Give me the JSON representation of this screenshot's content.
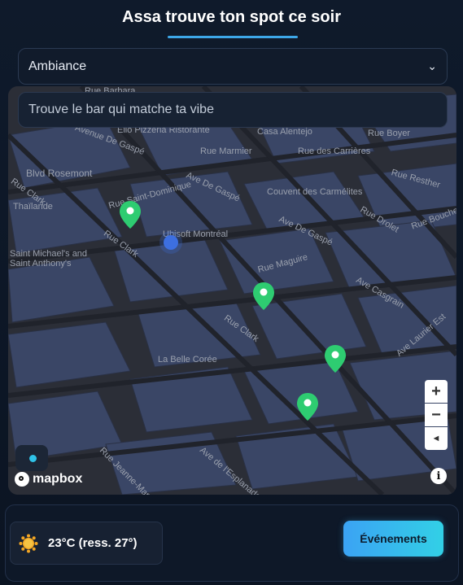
{
  "header": {
    "title": "Assa trouve ton spot ce soir"
  },
  "filter": {
    "selected": "Ambiance"
  },
  "search": {
    "placeholder": "Trouve le bar qui matche ta vibe"
  },
  "map": {
    "street_labels": [
      "Rue Saint-Dominique",
      "Rue Marmier",
      "Rue des Carrières",
      "Rue Boyer",
      "Rue Resther",
      "Blvd Rosemont",
      "Rue Clark",
      "Avenue De Gaspé",
      "Ave De Gaspé",
      "Rue Drolet",
      "Rue Boucher",
      "Rue Maguire",
      "Ave Casgrain",
      "Ave Laurier Est",
      "Ave de l'Esplanade",
      "Rue Jeanne-Mance"
    ],
    "poi_labels": [
      "Elio Pizzeria Ristorante",
      "Casa Alentejo",
      "Rue Barbara",
      "Couvent des Carmélites",
      "Ubisoft Montréal",
      "Saint Michael's and Saint Anthony's",
      "La Belle Corée",
      "Thaïlande"
    ],
    "markers_count": 4,
    "attribution": "mapbox",
    "zoom_in": "+",
    "zoom_out": "−",
    "compass": "◄",
    "info": "i"
  },
  "weather": {
    "text": "23°C (ress. 27°)"
  },
  "actions": {
    "events_label": "Événements"
  },
  "colors": {
    "accent": "#3da7e8",
    "marker": "#2ecc71",
    "user_location": "#3d6fe0"
  }
}
